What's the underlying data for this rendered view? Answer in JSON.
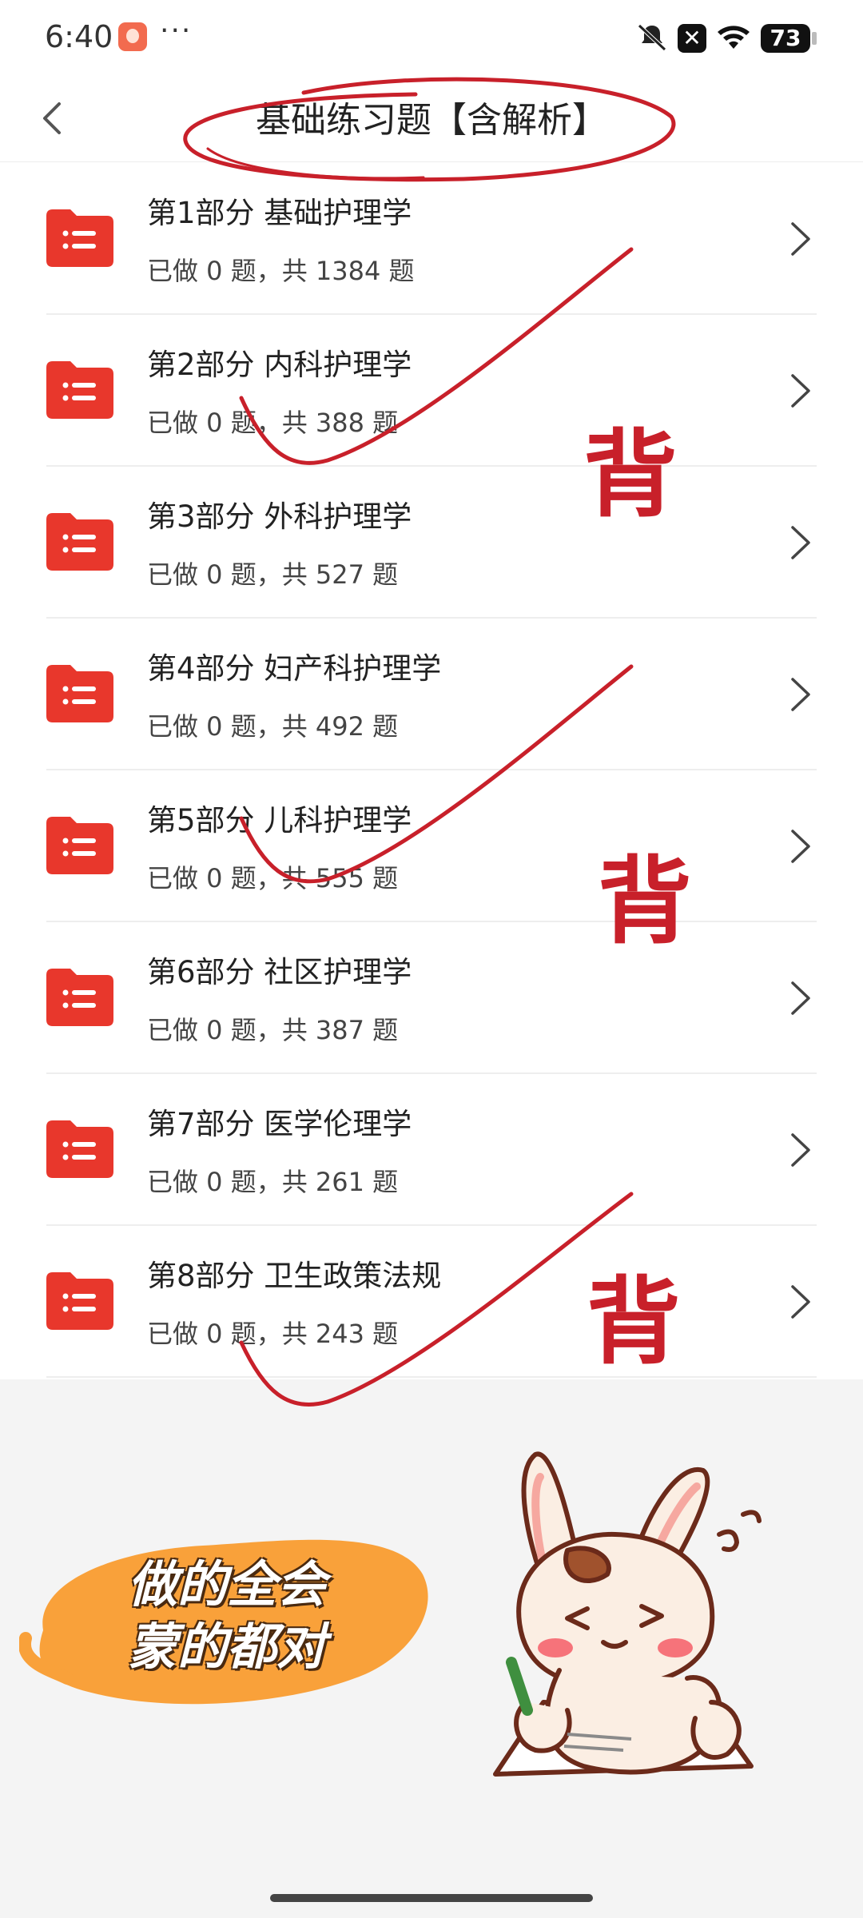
{
  "status_bar": {
    "time": "6:40",
    "more": "···",
    "close_glyph": "✕",
    "battery": "73"
  },
  "header": {
    "title": "基础练习题【含解析】"
  },
  "items": [
    {
      "title": "第1部分 基础护理学",
      "subtitle": "已做 0 题，共 1384 题"
    },
    {
      "title": "第2部分 内科护理学",
      "subtitle": "已做 0 题，共 388 题"
    },
    {
      "title": "第3部分 外科护理学",
      "subtitle": "已做 0 题，共 527 题"
    },
    {
      "title": "第4部分 妇产科护理学",
      "subtitle": "已做 0 题，共 492 题"
    },
    {
      "title": "第5部分 儿科护理学",
      "subtitle": "已做 0 题，共 555 题"
    },
    {
      "title": "第6部分 社区护理学",
      "subtitle": "已做 0 题，共 387 题"
    },
    {
      "title": "第7部分 医学伦理学",
      "subtitle": "已做 0 题，共 261 题"
    },
    {
      "title": "第8部分 卫生政策法规",
      "subtitle": "已做 0 题，共 243 题"
    }
  ],
  "annotations": {
    "mark_1": "背",
    "mark_2": "背",
    "mark_3": "背"
  },
  "motto": {
    "line1": "做的全会",
    "line2": "蒙的都对"
  },
  "icons": {
    "folder": "list-folder-icon",
    "row_arrow": "chevron-right-icon",
    "back": "chevron-left-icon"
  },
  "colors": {
    "folder_red": "#e8372c",
    "annotation_red": "#c8202a",
    "paint_orange": "#f9a13a"
  }
}
